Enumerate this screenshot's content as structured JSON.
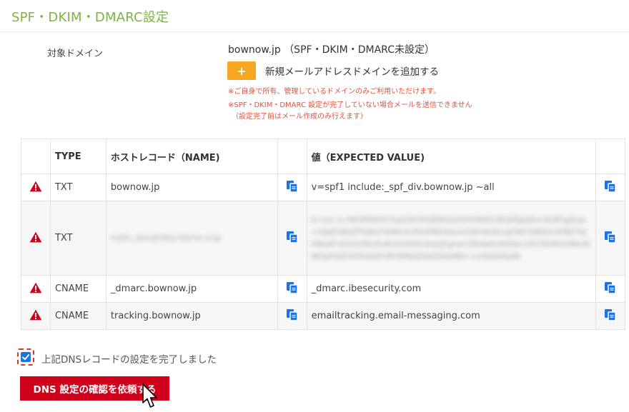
{
  "page": {
    "title": "SPF・DKIM・DMARC設定"
  },
  "domain": {
    "label": "対象ドメイン",
    "value": "bownow.jp （SPF・DKIM・DMARC未設定）",
    "add_button_symbol": "+",
    "add_link": "新規メールアドレスドメインを追加する",
    "note1": "※ご自身で所有、管理しているドメインのみご利用いただけます。",
    "note2_line1": "※SPF・DKIM・DMARC 設定が完了していない場合メールを送信できません",
    "note2_line2": "（設定完了前はメール作成のみ行えます）"
  },
  "table": {
    "headers": {
      "type": "TYPE",
      "host": "ホストレコード（NAME)",
      "value": "値（EXPECTED VALUE)"
    },
    "rows": [
      {
        "type": "TXT",
        "host": "bownow.jp",
        "value": "v=spf1 include:_spf_div.bownow.jp ~all"
      },
      {
        "type": "TXT",
        "host": "mailo._domainkey.nbarne.co.jp",
        "value": "k=rsa; p=MIGfMA0GCSqGSIb3DQEBAQUAA4GNADCBiQKBgQDxcWzRFgjZ/qs+rKJkJFe8OJTFlQ6eTO9WnItcfhiSPWDXeo1e28rh8ir6CxgFMeTQ8N1CdH8E7IQHNQAFvDOZXZKz5uIKxhGSt9XnbQzJ5gnsrLtZb4wEx/KKKbcvhFVTePAVIVMAnN8KSaHQtD4ODwdSFoRHWNq2J3dZDAQABl==ordQIDAQAB"
      },
      {
        "type": "CNAME",
        "host": "_dmarc.bownow.jp",
        "value": "_dmarc.ibesecurity.com"
      },
      {
        "type": "CNAME",
        "host": "tracking.bownow.jp",
        "value": "emailtracking.email-messaging.com"
      }
    ]
  },
  "confirm": {
    "checkbox_label": "上記DNSレコードの設定を完了しました",
    "checked": true,
    "submit_label": "DNS 設定の確認を依頼する"
  },
  "colors": {
    "title_green": "#7cb342",
    "accent_orange": "#f5a623",
    "note_red": "#e0533e",
    "warn_red": "#d0021b",
    "copy_blue": "#1a73e8",
    "submit_red": "#d0021b"
  },
  "icons": {
    "warn": "warning-triangle-icon",
    "copy": "copy-clipboard-icon",
    "cursor": "mouse-pointer-icon"
  }
}
